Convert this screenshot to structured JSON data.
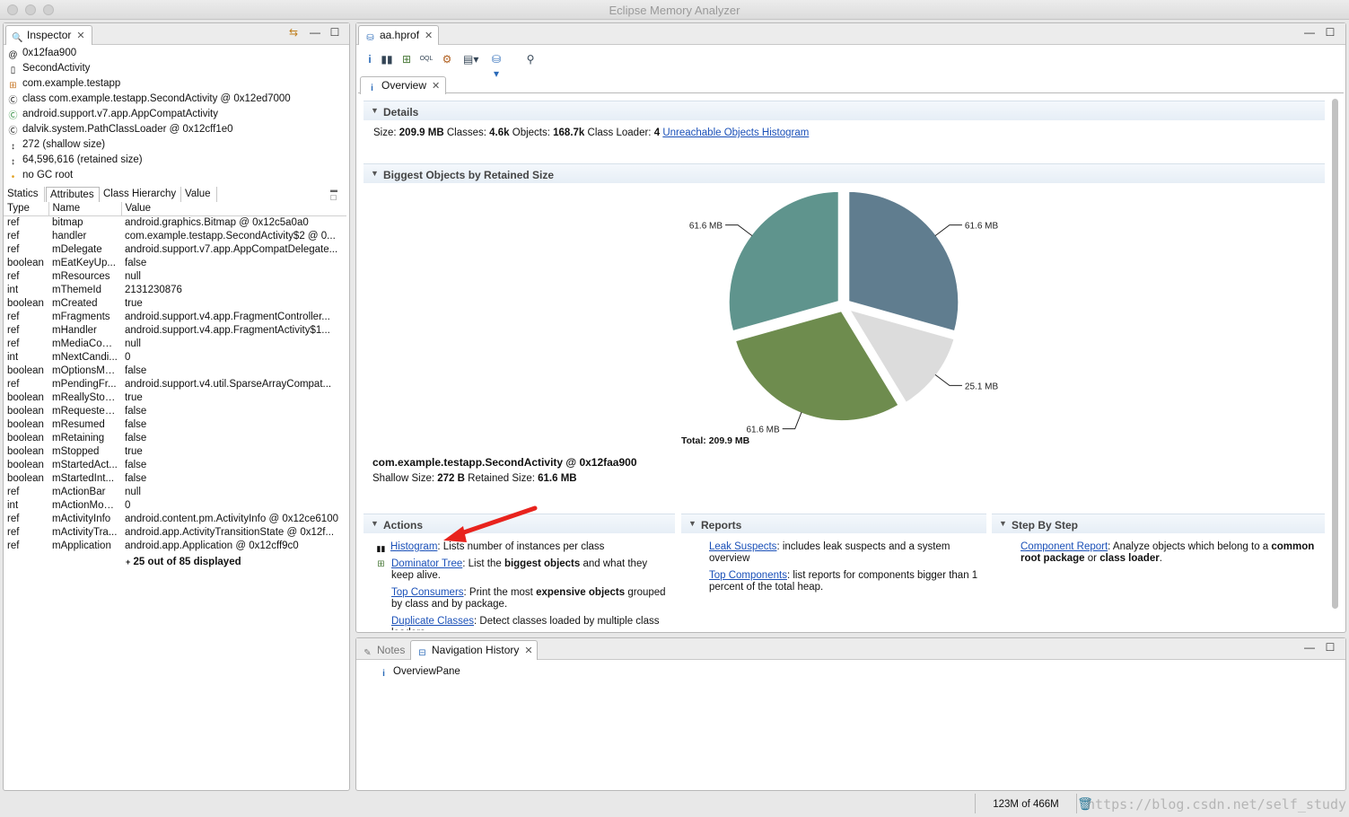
{
  "window": {
    "title": "Eclipse Memory Analyzer"
  },
  "inspector": {
    "tab_label": "Inspector",
    "rows": [
      {
        "icon": "at-icon",
        "text": "0x12faa900"
      },
      {
        "icon": "file-icon",
        "text": "SecondActivity"
      },
      {
        "icon": "package-icon",
        "text": "com.example.testapp"
      },
      {
        "icon": "class-icon",
        "text": "class com.example.testapp.SecondActivity @ 0x12ed7000"
      },
      {
        "icon": "superclass-icon",
        "text": "android.support.v7.app.AppCompatActivity"
      },
      {
        "icon": "classloader-icon",
        "text": "dalvik.system.PathClassLoader @ 0x12cff1e0"
      },
      {
        "icon": "size-icon",
        "text": "272 (shallow size)"
      },
      {
        "icon": "size-icon",
        "text": "64,596,616 (retained size)"
      },
      {
        "icon": "gc-root-icon",
        "text": "no GC root"
      }
    ],
    "subtabs": [
      "Statics",
      "Attributes",
      "Class Hierarchy",
      "Value"
    ],
    "columns": [
      "Type",
      "Name",
      "Value"
    ],
    "attributes": [
      [
        "ref",
        "bitmap",
        "android.graphics.Bitmap @ 0x12c5a0a0"
      ],
      [
        "ref",
        "handler",
        "com.example.testapp.SecondActivity$2 @ 0..."
      ],
      [
        "ref",
        "mDelegate",
        "android.support.v7.app.AppCompatDelegate..."
      ],
      [
        "boolean",
        "mEatKeyUp...",
        "false"
      ],
      [
        "ref",
        "mResources",
        "null"
      ],
      [
        "int",
        "mThemeId",
        "2131230876"
      ],
      [
        "boolean",
        "mCreated",
        "true"
      ],
      [
        "ref",
        "mFragments",
        "android.support.v4.app.FragmentController..."
      ],
      [
        "ref",
        "mHandler",
        "android.support.v4.app.FragmentActivity$1..."
      ],
      [
        "ref",
        "mMediaCont...",
        "null"
      ],
      [
        "int",
        "mNextCandi...",
        "0"
      ],
      [
        "boolean",
        "mOptionsMe...",
        "false"
      ],
      [
        "ref",
        "mPendingFr...",
        "android.support.v4.util.SparseArrayCompat..."
      ],
      [
        "boolean",
        "mReallyStop...",
        "true"
      ],
      [
        "boolean",
        "mRequested...",
        "false"
      ],
      [
        "boolean",
        "mResumed",
        "false"
      ],
      [
        "boolean",
        "mRetaining",
        "false"
      ],
      [
        "boolean",
        "mStopped",
        "true"
      ],
      [
        "boolean",
        "mStartedAct...",
        "false"
      ],
      [
        "boolean",
        "mStartedInt...",
        "false"
      ],
      [
        "ref",
        "mActionBar",
        "null"
      ],
      [
        "int",
        "mActionMod...",
        "0"
      ],
      [
        "ref",
        "mActivityInfo",
        "android.content.pm.ActivityInfo @ 0x12ce6100"
      ],
      [
        "ref",
        "mActivityTra...",
        "android.app.ActivityTransitionState @ 0x12f..."
      ],
      [
        "ref",
        "mApplication",
        "android.app.Application @ 0x12cff9c0"
      ]
    ],
    "footer": "25 out of 85 displayed"
  },
  "editor": {
    "file_tab": "aa.hprof",
    "overview_tab": "Overview",
    "toolbar_icons": [
      "info-icon",
      "histogram-icon",
      "dominator-tree-icon",
      "oql-icon",
      "heap-dump-overview-icon",
      "query-browser-icon",
      "find-object-icon",
      "search-icon"
    ]
  },
  "details": {
    "heading": "Details",
    "size_label": "Size:",
    "size_value": "209.9 MB",
    "classes_label": "Classes:",
    "classes_value": "4.6k",
    "objects_label": "Objects:",
    "objects_value": "168.7k",
    "loader_label": "Class Loader:",
    "loader_value": "4",
    "link": "Unreachable Objects Histogram"
  },
  "biggest": {
    "heading": "Biggest Objects by Retained Size",
    "total": "Total: 209.9 MB",
    "object_name": "com.example.testapp.SecondActivity @ 0x12faa900",
    "shallow_label": "Shallow Size:",
    "shallow_value": "272 B",
    "retained_label": "Retained Size:",
    "retained_value": "61.6 MB"
  },
  "chart_data": {
    "type": "pie",
    "categories": [
      "61.6 MB",
      "25.1 MB",
      "61.6 MB",
      "61.6 MB"
    ],
    "values": [
      61.6,
      25.1,
      61.6,
      61.6
    ],
    "colors": [
      "#607d8f",
      "#dcdcdc",
      "#6e8c4e",
      "#5f948d"
    ],
    "title": "",
    "total_label": "Total: 209.9 MB"
  },
  "actions": {
    "heading": "Actions",
    "items": [
      {
        "link": "Histogram",
        "text": ": Lists number of instances per class"
      },
      {
        "link": "Dominator Tree",
        "text_a": ": List the ",
        "bold": "biggest objects",
        "text_b": " and what they keep alive."
      },
      {
        "link": "Top Consumers",
        "text_a": ": Print the most ",
        "bold": "expensive objects",
        "text_b": " grouped by class and by package."
      },
      {
        "link": "Duplicate Classes",
        "text": ": Detect classes loaded by multiple class loaders."
      }
    ]
  },
  "reports": {
    "heading": "Reports",
    "items": [
      {
        "link": "Leak Suspects",
        "text": ": includes leak suspects and a system overview"
      },
      {
        "link": "Top Components",
        "text": ": list reports for components bigger than 1 percent of the total heap."
      }
    ]
  },
  "stepbystep": {
    "heading": "Step By Step",
    "link": "Component Report",
    "text_a": ": Analyze objects which belong to a ",
    "bold_a": "common root package",
    "text_b": " or ",
    "bold_b": "class loader",
    "text_c": "."
  },
  "bottom": {
    "notes_tab": "Notes",
    "nav_tab": "Navigation History",
    "nav_item": "OverviewPane"
  },
  "status": {
    "heap": "123M of 466M",
    "watermark": "https://blog.csdn.net/self_study"
  }
}
